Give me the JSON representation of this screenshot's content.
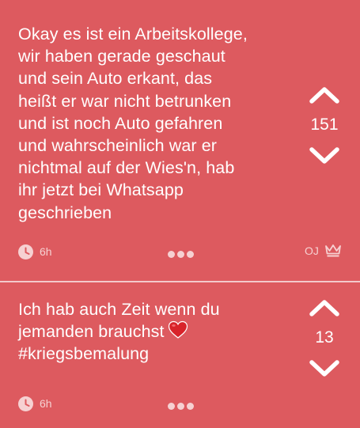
{
  "posts": [
    {
      "text": "Okay es ist ein Arbeitskollege,\nwir haben gerade geschaut\nund sein Auto erkant, das\nheißt er war nicht betrunken\nund ist noch Auto gefahren\nund wahrscheinlich war er\nnichtmal auf der Wies'n, hab\nihr jetzt bei Whatsapp\ngeschrieben",
      "votes": "151",
      "time": "6h",
      "author_badge": "OJ"
    },
    {
      "text": "Ich hab auch Zeit wenn du\njemanden brauchst",
      "hashtag": "#kriegsbemalung",
      "votes": "13",
      "time": "6h"
    }
  ],
  "icons": {
    "upvote": "chevron-up-icon",
    "downvote": "chevron-down-icon",
    "clock": "clock-icon",
    "more": "more-dots-icon",
    "crown": "crown-icon",
    "heart": "heart-icon"
  },
  "colors": {
    "background": "#dd5a5f",
    "text": "#ffffff",
    "muted": "#f6d1d2",
    "heart": "#d8232a"
  }
}
